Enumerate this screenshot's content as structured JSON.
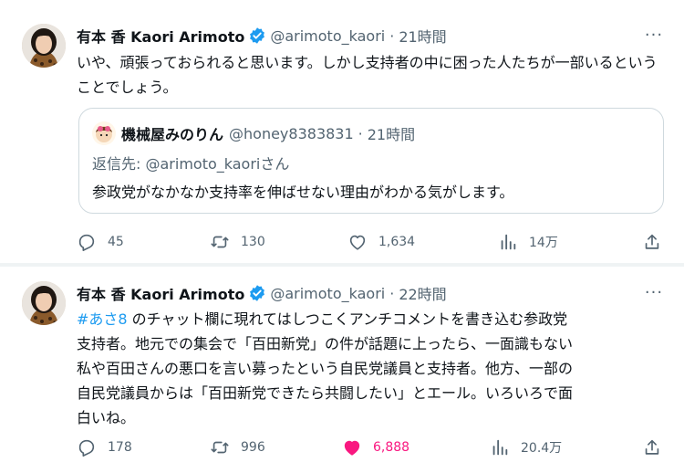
{
  "tweets": [
    {
      "author_name": "有本 香 Kaori Arimoto",
      "handle": "@arimoto_kaori",
      "time": "21時間",
      "text": "いや、頑張っておられると思います。しかし支持者の中に困った人たちが一部いるということでしょう。",
      "quote": {
        "author_name": "機械屋みのりん",
        "handle": "@honey8383831",
        "time": "21時間",
        "reply_prefix": "返信先: ",
        "reply_handle": "@arimoto_kaori",
        "reply_suffix": "さん",
        "text": "参政党がなかなか支持率を伸ばせない理由がわかる気がします。"
      },
      "actions": {
        "replies": "45",
        "retweets": "130",
        "likes": "1,634",
        "views": "14万",
        "liked": false
      }
    },
    {
      "author_name": "有本 香 Kaori Arimoto",
      "handle": "@arimoto_kaori",
      "time": "22時間",
      "hashtag": "#あさ8",
      "text_lines": [
        " のチャット欄に現れてはしつこくアンチコメントを書き込む参政党",
        "支持者。地元での集会で「百田新党」の件が話題に上ったら、一面識もない",
        "私や百田さんの悪口を言い募ったという自民党議員と支持者。他方、一部の",
        "自民党議員からは「百田新党できたら共闘したい」とエール。いろいろで面",
        "白いね。"
      ],
      "actions": {
        "replies": "178",
        "retweets": "996",
        "likes": "6,888",
        "views": "20.4万",
        "liked": true
      }
    }
  ],
  "icons": {
    "verified": "verified-badge-icon",
    "more": "more-dots-icon",
    "reply": "reply-icon",
    "retweet": "retweet-icon",
    "like": "heart-icon",
    "views": "views-icon",
    "share": "share-icon"
  },
  "colors": {
    "text": "#0f1419",
    "secondary": "#536471",
    "link": "#1d9bf0",
    "like": "#f91880",
    "divider": "#eff3f4"
  }
}
